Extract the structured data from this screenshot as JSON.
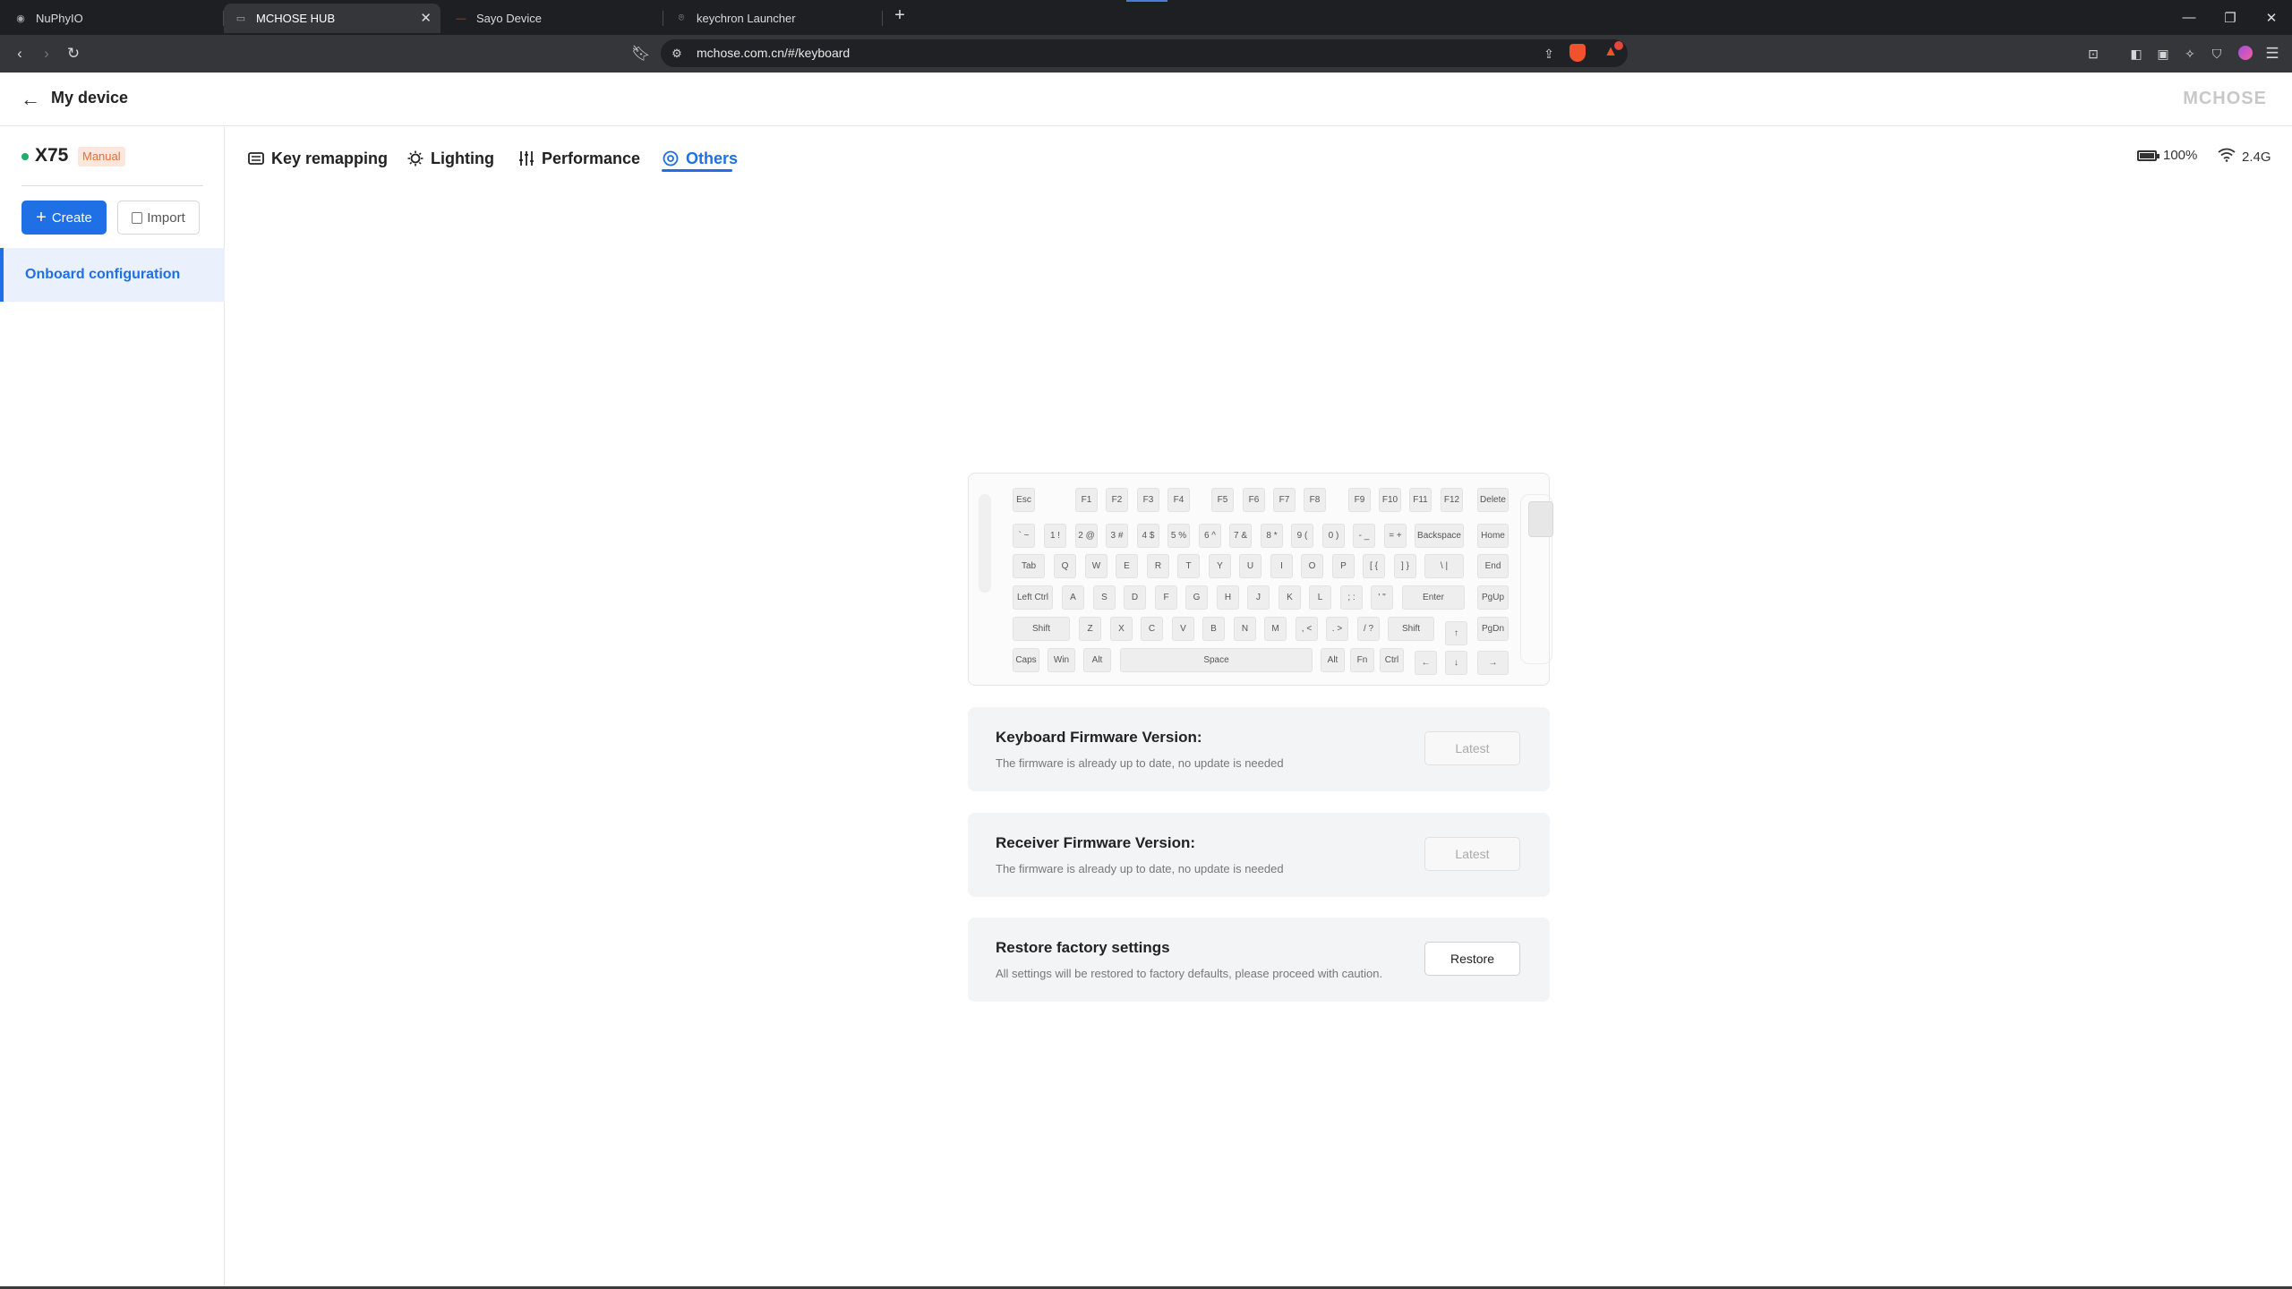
{
  "browser": {
    "tabs": [
      {
        "title": "NuPhyIO",
        "active": false
      },
      {
        "title": "MCHOSE HUB",
        "active": true
      },
      {
        "title": "Sayo Device",
        "active": false
      },
      {
        "title": "keychron Launcher",
        "active": false
      }
    ],
    "new_tab": "+",
    "url": "mchose.com.cn/#/keyboard"
  },
  "header": {
    "title": "My device",
    "brand": "MCHOSE"
  },
  "sidebar": {
    "device_name": "X75",
    "mode_badge": "Manual",
    "create_label": "Create",
    "import_label": "Import",
    "items": [
      {
        "label": "Onboard configuration",
        "selected": true
      }
    ]
  },
  "nav": {
    "tabs": [
      {
        "label": "Key remapping",
        "icon": "keyboard-icon"
      },
      {
        "label": "Lighting",
        "icon": "bulb-icon"
      },
      {
        "label": "Performance",
        "icon": "sliders-icon"
      },
      {
        "label": "Others",
        "icon": "gear-icon",
        "active": true
      }
    ],
    "battery": "100%",
    "connection": "2.4G"
  },
  "keyboard": {
    "rows": [
      [
        "Esc",
        "F1",
        "F2",
        "F3",
        "F4",
        "F5",
        "F6",
        "F7",
        "F8",
        "F9",
        "F10",
        "F11",
        "F12",
        "Delete"
      ],
      [
        "` ~",
        "1 !",
        "2 @",
        "3 #",
        "4 $",
        "5 %",
        "6 ^",
        "7 &",
        "8 *",
        "9 (",
        "0 )",
        "- _",
        "= +",
        "Backspace",
        "Home"
      ],
      [
        "Tab",
        "Q",
        "W",
        "E",
        "R",
        "T",
        "Y",
        "U",
        "I",
        "O",
        "P",
        "[ {",
        "] }",
        "\\ |",
        "End"
      ],
      [
        "Left Ctrl",
        "A",
        "S",
        "D",
        "F",
        "G",
        "H",
        "J",
        "K",
        "L",
        "; :",
        "' \"",
        "Enter",
        "PgUp"
      ],
      [
        "Shift",
        "Z",
        "X",
        "C",
        "V",
        "B",
        "N",
        "M",
        ", <",
        ". >",
        "/ ?",
        "Shift",
        "↑",
        "PgDn"
      ],
      [
        "Caps",
        "Win",
        "Alt",
        "Space",
        "Alt",
        "Fn",
        "Ctrl",
        "←",
        "↓",
        "→"
      ]
    ]
  },
  "cards": [
    {
      "title": "Keyboard Firmware Version:",
      "desc": "The firmware is already up to date, no update is needed",
      "button": "Latest",
      "enabled": false
    },
    {
      "title": "Receiver Firmware Version:",
      "desc": "The firmware is already up to date, no update is needed",
      "button": "Latest",
      "enabled": false
    },
    {
      "title": "Restore factory settings",
      "desc": "All settings will be restored to factory defaults, please proceed with caution.",
      "button": "Restore",
      "enabled": true
    }
  ],
  "colors": {
    "accent": "#1f6fe5",
    "badge_bg": "#fde6dc",
    "badge_text": "#e4703c",
    "online_dot": "#1bb06a"
  }
}
